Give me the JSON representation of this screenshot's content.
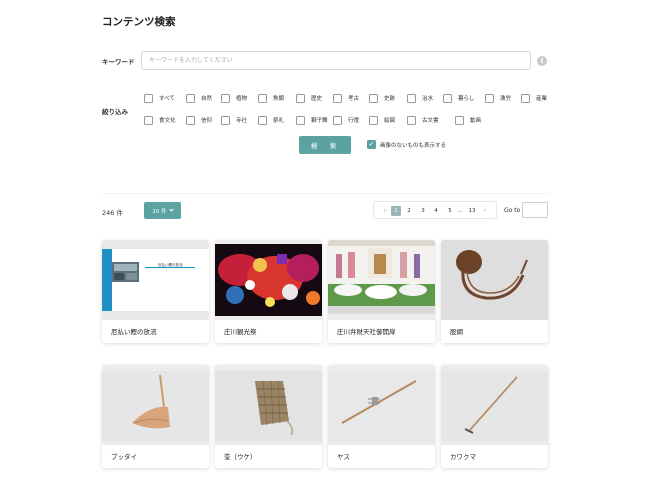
{
  "page_title": "コンテンツ検索",
  "keyword": {
    "label": "キーワード",
    "placeholder": "キーワードを入力してください",
    "value": "",
    "info_icon": "info-icon"
  },
  "filter": {
    "label": "絞り込み",
    "row1": [
      {
        "label": "すべて",
        "checked": false
      },
      {
        "label": "自然",
        "checked": false
      },
      {
        "label": "植物",
        "checked": false
      },
      {
        "label": "魚類",
        "checked": false
      },
      {
        "label": "歴史",
        "checked": false
      },
      {
        "label": "考古",
        "checked": false
      },
      {
        "label": "史跡",
        "checked": false
      },
      {
        "label": "治水",
        "checked": false
      },
      {
        "label": "暮らし",
        "checked": false
      },
      {
        "label": "漁労",
        "checked": false
      },
      {
        "label": "産業",
        "checked": false
      }
    ],
    "row2": [
      {
        "label": "食文化",
        "checked": false
      },
      {
        "label": "信仰",
        "checked": false
      },
      {
        "label": "寺社",
        "checked": false
      },
      {
        "label": "祭礼",
        "checked": false
      },
      {
        "label": "獅子舞",
        "checked": false
      },
      {
        "label": "行燈",
        "checked": false
      },
      {
        "label": "絵図",
        "checked": false
      },
      {
        "label": "古文書",
        "checked": false
      },
      {
        "label": "動画",
        "checked": false
      }
    ]
  },
  "search_button": "検　索",
  "show_no_image": {
    "label": "画像のないものも表示する",
    "checked": true
  },
  "results": {
    "count": "246 件",
    "per_page": "20 件",
    "pagination": {
      "prev": "‹",
      "pages": [
        "1",
        "2",
        "3",
        "4",
        "5",
        "...",
        "13"
      ],
      "current": "1",
      "next": "›"
    },
    "goto_label": "Go to",
    "goto_value": ""
  },
  "cards": [
    {
      "title": "厄払い鰹の放流",
      "thumb_caption": "厄払い鰹の放流",
      "accent": "#1f8fc4"
    },
    {
      "title": "庄川観光祭"
    },
    {
      "title": "庄川弁財天社御開扉"
    },
    {
      "title": "股網"
    },
    {
      "title": "ブッタイ"
    },
    {
      "title": "筌（ウケ）"
    },
    {
      "title": "ヤス"
    },
    {
      "title": "カワクマ"
    }
  ]
}
